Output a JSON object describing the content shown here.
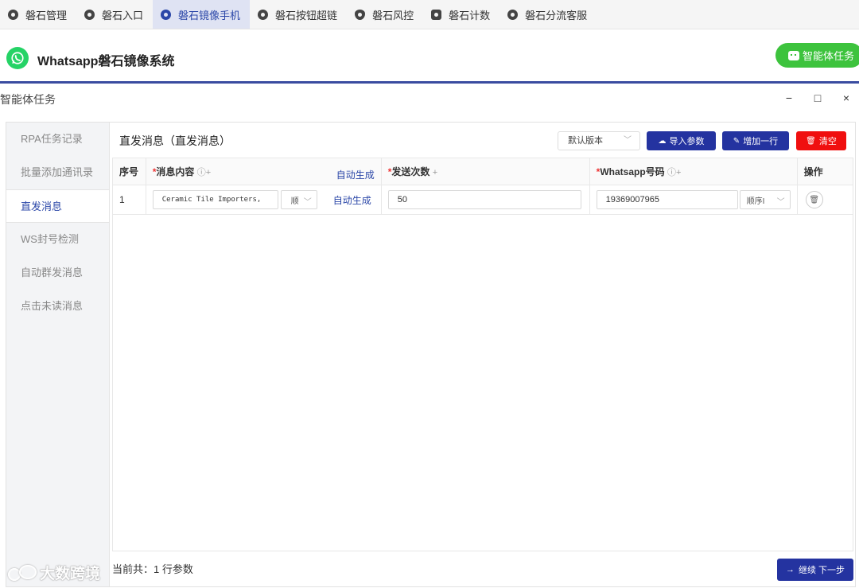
{
  "topnav": {
    "tabs": [
      {
        "label": "磐石管理",
        "icon": "gear-icon",
        "active": false
      },
      {
        "label": "磐石入口",
        "icon": "compass-icon",
        "active": false
      },
      {
        "label": "磐石镜像手机",
        "icon": "gear-icon",
        "active": true
      },
      {
        "label": "磐石按钮超链",
        "icon": "compass-icon",
        "active": false
      },
      {
        "label": "磐石风控",
        "icon": "shield-icon",
        "active": false
      },
      {
        "label": "磐石计数",
        "icon": "chart-icon",
        "active": false
      },
      {
        "label": "磐石分流客服",
        "icon": "compass-icon",
        "active": false
      }
    ]
  },
  "header": {
    "title": "Whatsapp磐石镜像系统",
    "agent_button": "智能体任务"
  },
  "window": {
    "title": "智能体任务",
    "minimize": "−",
    "maximize": "□",
    "close": "×"
  },
  "sidebar": {
    "items": [
      {
        "label": "RPA任务记录",
        "active": false
      },
      {
        "label": "批量添加通讯录",
        "active": false
      },
      {
        "label": "直发消息",
        "active": true
      },
      {
        "label": "WS封号检测",
        "active": false
      },
      {
        "label": "自动群发消息",
        "active": false
      },
      {
        "label": "点击未读消息",
        "active": false
      }
    ]
  },
  "main": {
    "section_title": "直发消息（直发消息）",
    "version_select": "默认版本",
    "import_button": "导入参数",
    "add_row_button": "增加一行",
    "clear_button": "清空",
    "table": {
      "headers": {
        "index": "序号",
        "message_required": "*",
        "message": "消息内容",
        "message_hint": "ⓘ+",
        "auto_gen": "自动生成",
        "count_required": "*",
        "count": "发送次数",
        "count_hint": "+",
        "phone_required": "*",
        "phone": "Whatsapp号码",
        "phone_hint": "ⓘ+",
        "action": "操作"
      },
      "rows": [
        {
          "index": "1",
          "message": "Ceramic Tile Importers,",
          "message_order": "顺",
          "auto_gen": "自动生成",
          "count": "50",
          "phone": "19369007965",
          "phone_order": "顺序I"
        }
      ]
    },
    "footer_text": "当前共：1 行参数",
    "next_button": "继续 下一步"
  },
  "watermark": "大数跨境",
  "colors": {
    "primary": "#2433a0",
    "danger": "#f00f0f",
    "success": "#3dc33d",
    "whatsapp": "#25d366"
  }
}
